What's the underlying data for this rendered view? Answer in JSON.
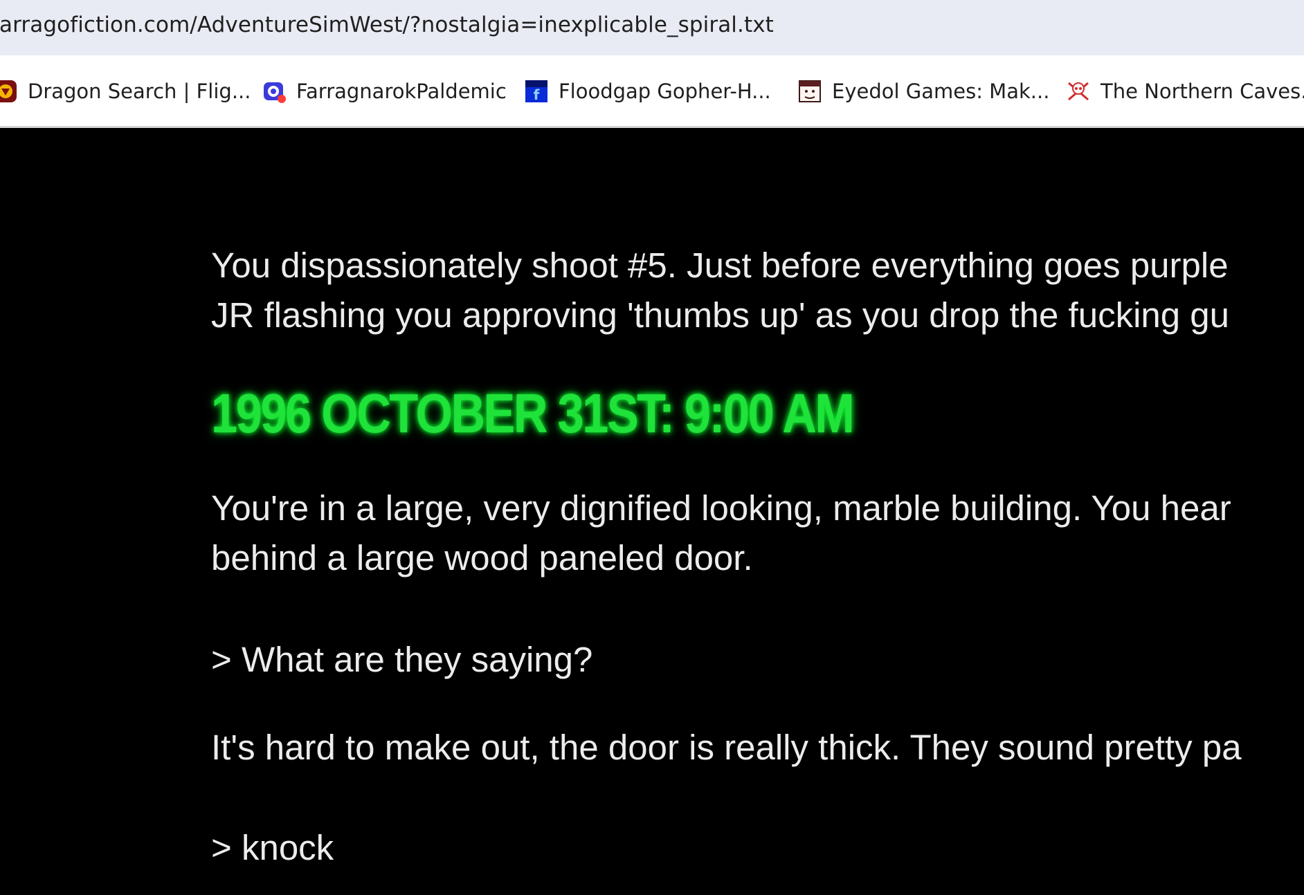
{
  "browser": {
    "address": "farragofiction.com/AdventureSimWest/?nostalgia=inexplicable_spiral.txt",
    "bookmarks": [
      {
        "label": "Dragon Search | Flig...",
        "icon": "dragon-favicon-icon"
      },
      {
        "label": "FarragnarokPaldemic",
        "icon": "eye-favicon-icon"
      },
      {
        "label": "Floodgap Gopher-H...",
        "icon": "floodgap-favicon-icon"
      },
      {
        "label": "Eyedol Games: Mak...",
        "icon": "face-favicon-icon"
      },
      {
        "label": "The Northern Caves...",
        "icon": "skull-favicon-icon"
      }
    ]
  },
  "story": {
    "para1_line1": "You dispassionately shoot #5. Just before everything goes purple",
    "para1_line2": "JR flashing you approving 'thumbs up' as you drop the fucking gu",
    "heading": "1996 OCTOBER 31ST: 9:00 AM",
    "para2_line1": "You're in a large, very dignified looking, marble building. You hear",
    "para2_line2": "behind a large wood paneled door.",
    "command1": "> What are they saying?",
    "para3_line1": "It's hard to make out, the door is really thick. They sound pretty pa",
    "command2": "> knock"
  },
  "colors": {
    "background": "#000000",
    "text": "#ececec",
    "heading": "#1fe23a"
  }
}
